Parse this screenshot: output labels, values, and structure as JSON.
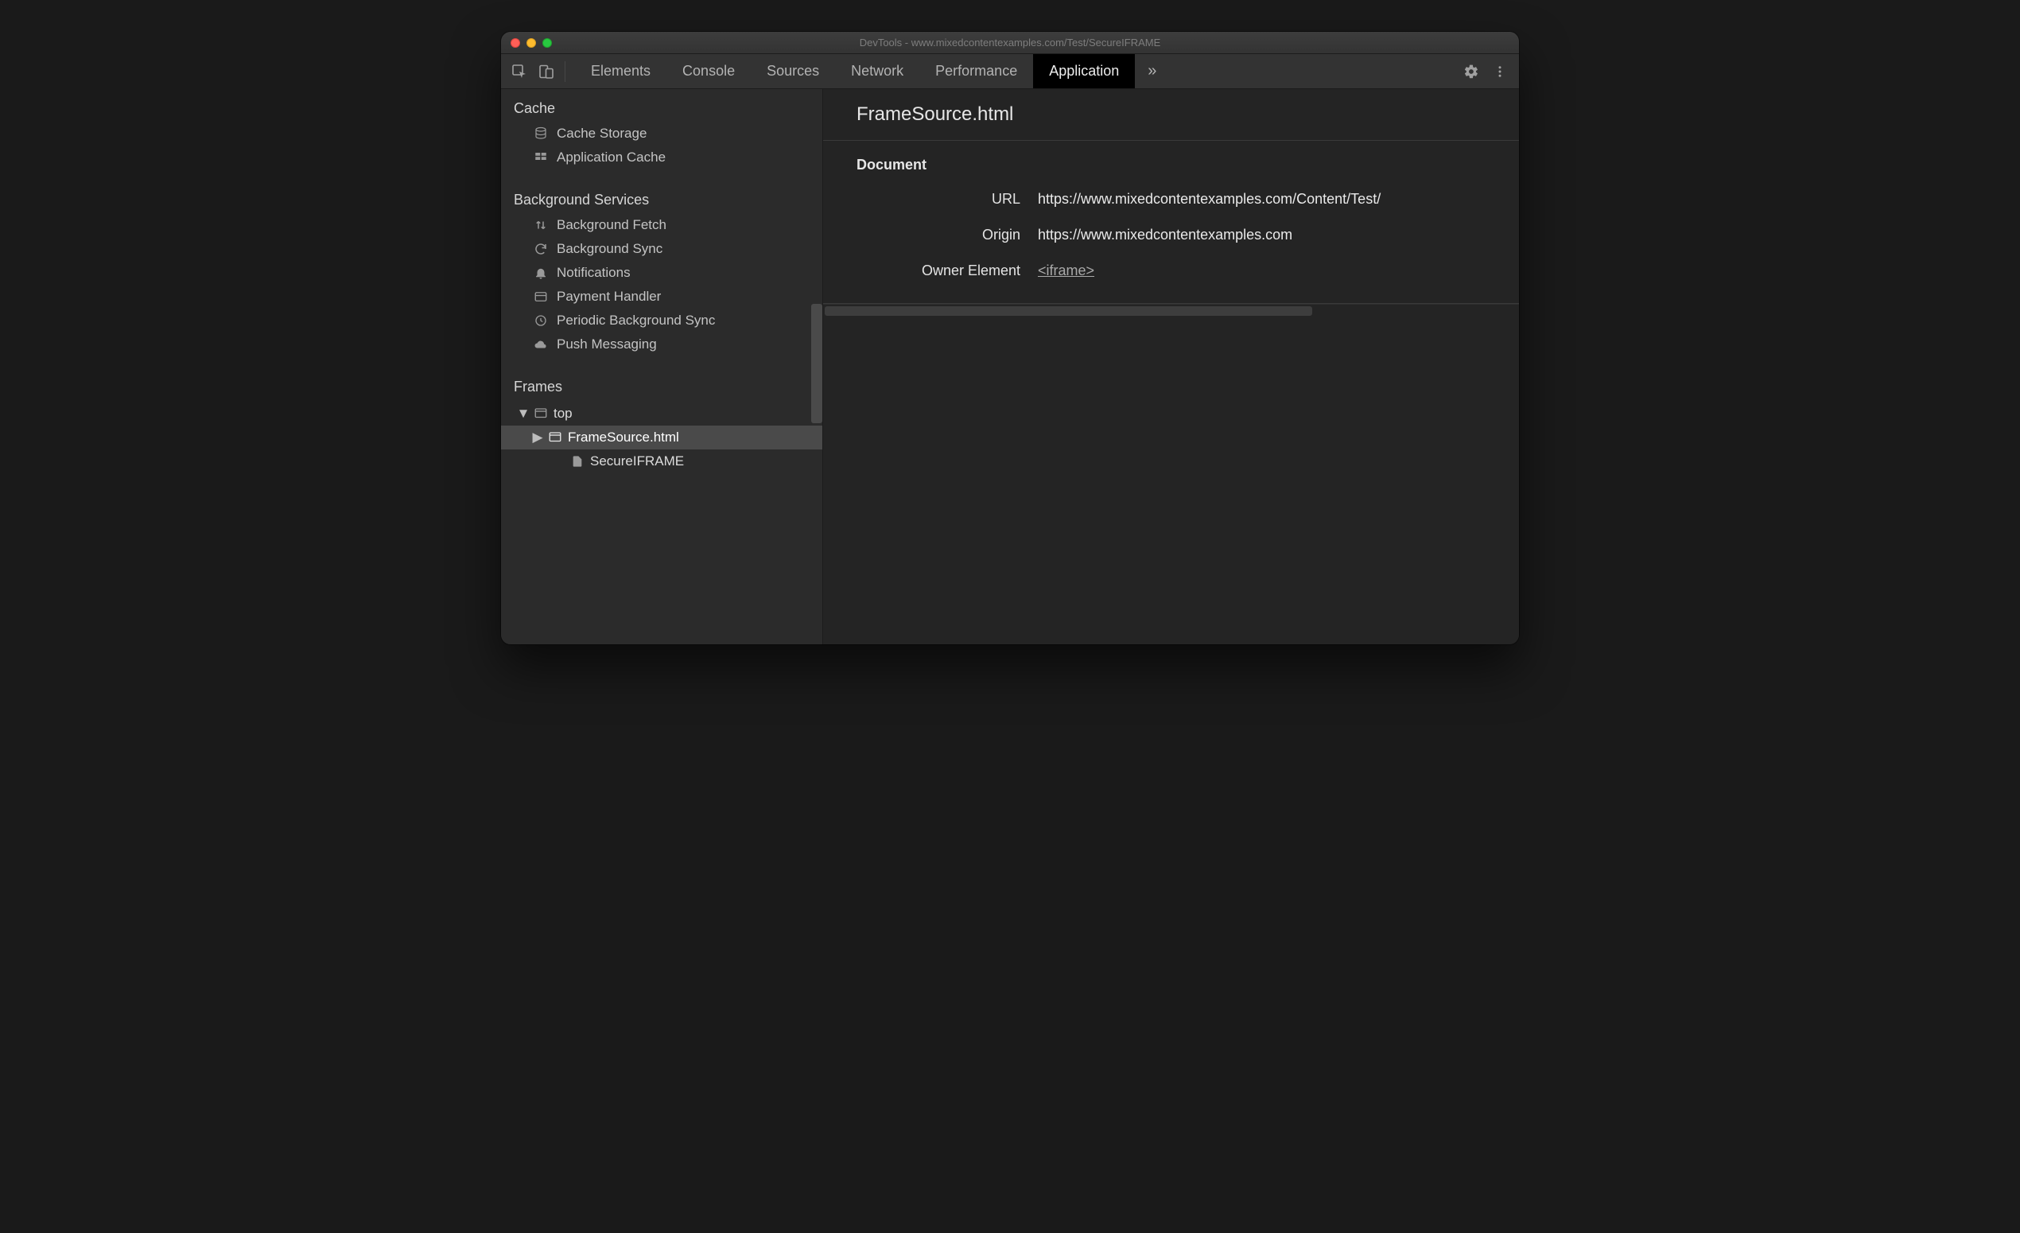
{
  "window": {
    "title": "DevTools - www.mixedcontentexamples.com/Test/SecureIFRAME"
  },
  "toolbar": {
    "tabs": [
      {
        "label": "Elements",
        "active": false
      },
      {
        "label": "Console",
        "active": false
      },
      {
        "label": "Sources",
        "active": false
      },
      {
        "label": "Network",
        "active": false
      },
      {
        "label": "Performance",
        "active": false
      },
      {
        "label": "Application",
        "active": true
      }
    ]
  },
  "sidebar": {
    "cache": {
      "title": "Cache",
      "items": [
        {
          "label": "Cache Storage",
          "icon": "database-icon"
        },
        {
          "label": "Application Cache",
          "icon": "grid-icon"
        }
      ]
    },
    "background_services": {
      "title": "Background Services",
      "items": [
        {
          "label": "Background Fetch",
          "icon": "arrows-updown-icon"
        },
        {
          "label": "Background Sync",
          "icon": "sync-icon"
        },
        {
          "label": "Notifications",
          "icon": "bell-icon"
        },
        {
          "label": "Payment Handler",
          "icon": "card-icon"
        },
        {
          "label": "Periodic Background Sync",
          "icon": "clock-icon"
        },
        {
          "label": "Push Messaging",
          "icon": "cloud-icon"
        }
      ]
    },
    "frames": {
      "title": "Frames",
      "tree": {
        "top_label": "top",
        "child_label": "FrameSource.html",
        "leaf_label": "SecureIFRAME"
      }
    }
  },
  "main": {
    "title": "FrameSource.html",
    "document_section_title": "Document",
    "url_label": "URL",
    "url_value": "https://www.mixedcontentexamples.com/Content/Test/",
    "origin_label": "Origin",
    "origin_value": "https://www.mixedcontentexamples.com",
    "owner_label": "Owner Element",
    "owner_value": "<iframe>"
  }
}
